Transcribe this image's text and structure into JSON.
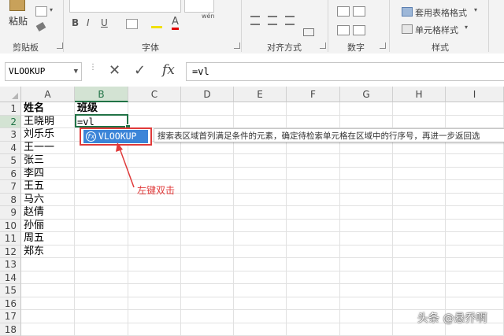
{
  "ribbon": {
    "clipboard": {
      "paste_label": "粘贴",
      "group_label": "剪贴板"
    },
    "font": {
      "bold": "B",
      "italic": "I",
      "underline": "U",
      "font_color_glyph": "A",
      "wen_glyph": "wén",
      "group_label": "字体"
    },
    "alignment": {
      "group_label": "对齐方式"
    },
    "number": {
      "group_label": "数字"
    },
    "styles": {
      "table_format_label": "套用表格格式",
      "cell_style_label": "单元格样式",
      "group_label": "样式"
    }
  },
  "formula_bar": {
    "name_box": "VLOOKUP",
    "cancel_glyph": "✕",
    "enter_glyph": "✓",
    "fx_glyph": "fx",
    "formula": "=vl"
  },
  "sheet": {
    "columns": [
      "A",
      "B",
      "C",
      "D",
      "E",
      "F",
      "G",
      "H",
      "I"
    ],
    "rows": [
      "1",
      "2",
      "3",
      "4",
      "5",
      "6",
      "7",
      "8",
      "9",
      "10",
      "11",
      "12",
      "13",
      "14",
      "15",
      "16",
      "17",
      "18"
    ],
    "cells": {
      "A1": "姓名",
      "B1": "班级",
      "A2": "王晓明",
      "B2": "=vl",
      "A3": "刘乐乐",
      "A4": "王一一",
      "A5": "张三",
      "A6": "李四",
      "A7": "王五",
      "A8": "马六",
      "A9": "赵倩",
      "A10": "孙俪",
      "A11": "周五",
      "A12": "郑东"
    },
    "selected_column": "B",
    "selected_row": "2"
  },
  "autocomplete": {
    "item": "VLOOKUP",
    "fn_icon_glyph": "fx",
    "tooltip": "搜索表区域首列满足条件的元素，确定待检索单元格在区域中的行序号，再进一步返回选"
  },
  "annotation": {
    "text": "左键双击",
    "color": "#e03a3a"
  },
  "watermark": {
    "text": "头条 @悬乔啊"
  },
  "colors": {
    "excel_green": "#217346",
    "autocomplete_blue": "#3c85d8",
    "annotation_red": "#e03a3a"
  }
}
